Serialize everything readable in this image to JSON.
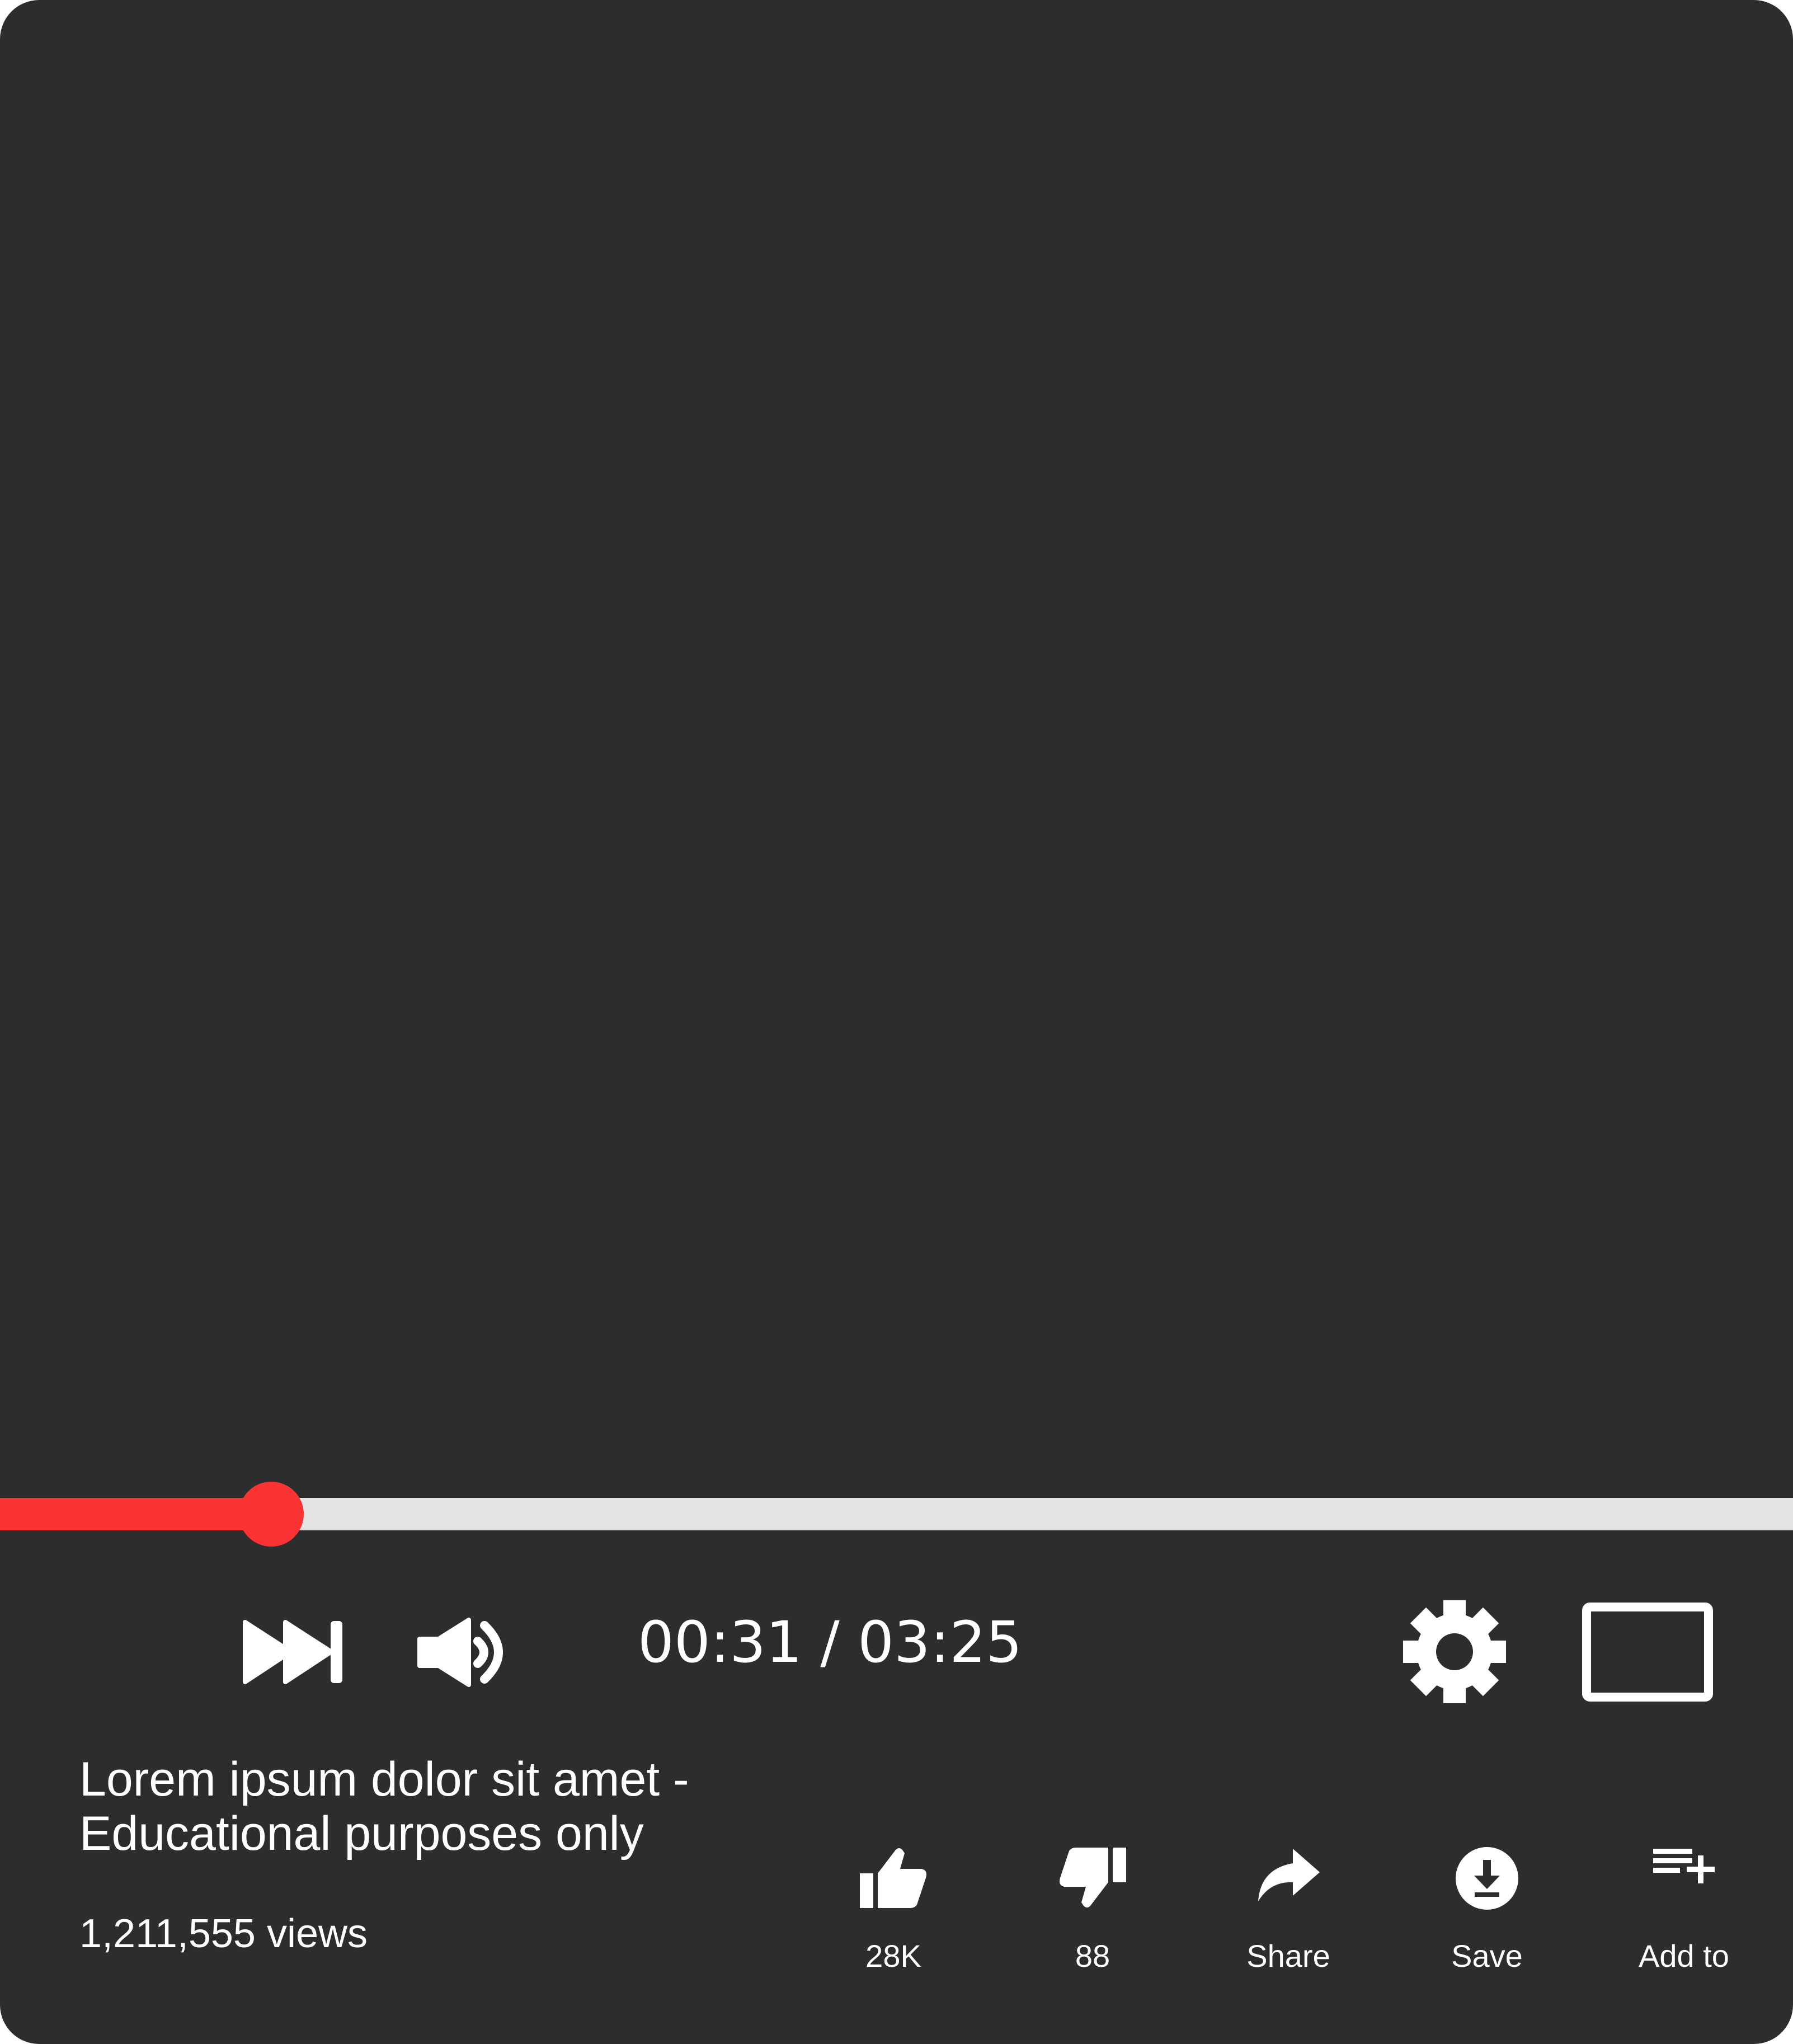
{
  "player": {
    "progress_fraction": 0.1512,
    "colors": {
      "background": "#2d2d2d",
      "played": "#fa3434",
      "unplayed": "#e3e3e3",
      "foreground": "#ffffff"
    }
  },
  "controls": {
    "next_icon": "skip-next-icon",
    "volume_icon": "volume-icon",
    "time": "00:31 / 03:25",
    "settings_icon": "gear-icon",
    "theater_icon": "theater-mode-icon"
  },
  "video": {
    "title_line1": "Lorem ipsum dolor sit amet -",
    "title_line2": "Educational purposes only",
    "views": "1,211,555 views"
  },
  "actions": {
    "like": {
      "icon": "thumbs-up-icon",
      "label": "28K"
    },
    "dislike": {
      "icon": "thumbs-down-icon",
      "label": "88"
    },
    "share": {
      "icon": "share-arrow-icon",
      "label": "Share"
    },
    "save": {
      "icon": "download-icon",
      "label": "Save"
    },
    "add_to": {
      "icon": "playlist-add-icon",
      "label": "Add to"
    }
  }
}
